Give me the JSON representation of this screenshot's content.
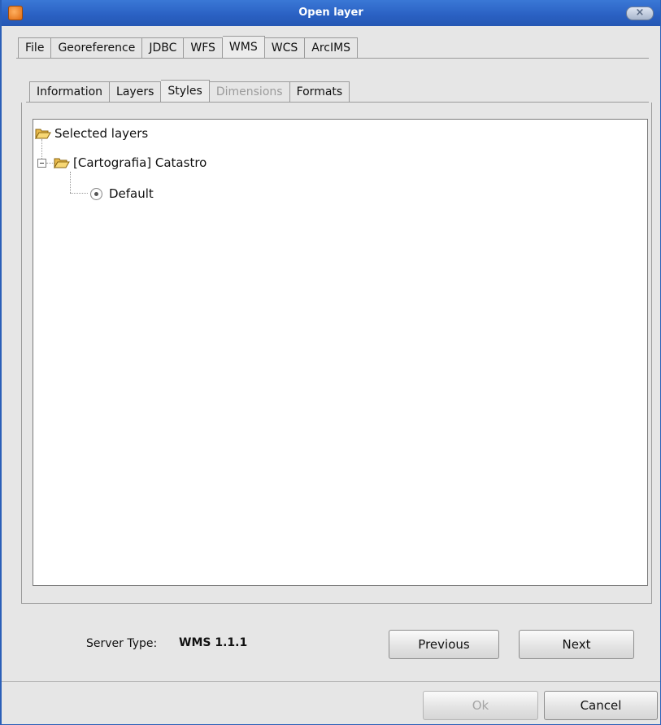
{
  "window": {
    "title": "Open layer"
  },
  "outer_tabs": [
    "File",
    "Georeference",
    "JDBC",
    "WFS",
    "WMS",
    "WCS",
    "ArcIMS"
  ],
  "outer_active": "WMS",
  "inner_tabs": [
    "Information",
    "Layers",
    "Styles",
    "Dimensions",
    "Formats"
  ],
  "inner_active": "Styles",
  "inner_disabled": "Dimensions",
  "tree": {
    "root": "Selected layers",
    "layer": "[Cartografia] Catastro",
    "style": "Default"
  },
  "server": {
    "label": "Server Type:",
    "value": "WMS 1.1.1"
  },
  "buttons": {
    "previous": "Previous",
    "next": "Next",
    "ok": "Ok",
    "cancel": "Cancel"
  },
  "icons": {
    "app": "gvsig-app-icon",
    "close": "close-icon",
    "folder": "folder-open-icon",
    "radio": "radio-selected-icon"
  }
}
